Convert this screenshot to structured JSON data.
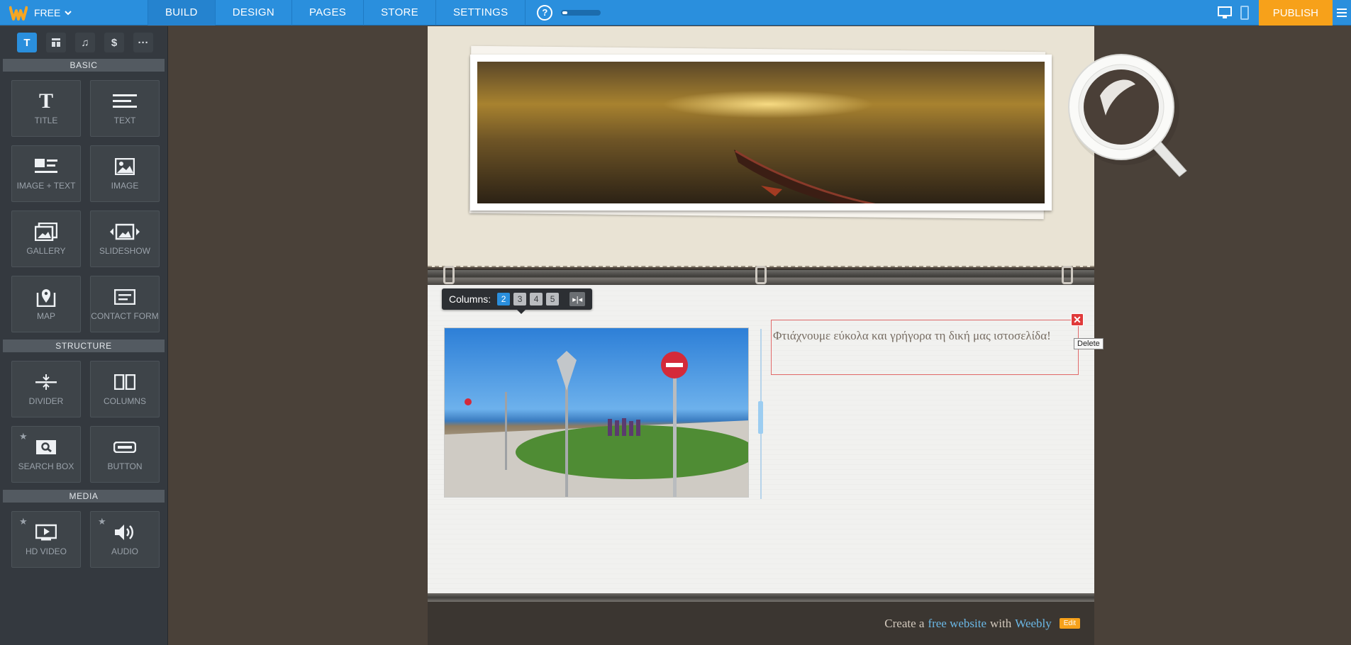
{
  "topbar": {
    "logo": "W",
    "plan": "FREE",
    "tabs": [
      {
        "label": "BUILD",
        "active": true
      },
      {
        "label": "DESIGN",
        "active": false
      },
      {
        "label": "PAGES",
        "active": false
      },
      {
        "label": "STORE",
        "active": false
      },
      {
        "label": "SETTINGS",
        "active": false
      }
    ],
    "help": "?",
    "progress": 0.12,
    "publish": "PUBLISH"
  },
  "sidebar": {
    "sections": {
      "basic": "BASIC",
      "structure": "STRUCTURE",
      "media": "MEDIA"
    },
    "basic_items": [
      {
        "label": "TITLE",
        "icon": "title-icon"
      },
      {
        "label": "TEXT",
        "icon": "text-icon"
      },
      {
        "label": "IMAGE + TEXT",
        "icon": "image-text-icon"
      },
      {
        "label": "IMAGE",
        "icon": "image-icon"
      },
      {
        "label": "GALLERY",
        "icon": "gallery-icon"
      },
      {
        "label": "SLIDESHOW",
        "icon": "slideshow-icon"
      },
      {
        "label": "MAP",
        "icon": "map-icon"
      },
      {
        "label": "CONTACT FORM",
        "icon": "contact-form-icon"
      }
    ],
    "structure_items": [
      {
        "label": "DIVIDER",
        "icon": "divider-icon"
      },
      {
        "label": "COLUMNS",
        "icon": "columns-icon"
      },
      {
        "label": "SEARCH BOX",
        "icon": "search-box-icon",
        "starred": true
      },
      {
        "label": "BUTTON",
        "icon": "button-icon"
      }
    ],
    "media_items": [
      {
        "label": "HD VIDEO",
        "icon": "video-icon",
        "starred": true
      },
      {
        "label": "AUDIO",
        "icon": "audio-icon",
        "starred": true
      }
    ]
  },
  "editor": {
    "columns_label": "Columns:",
    "column_options": [
      "2",
      "3",
      "4",
      "5"
    ],
    "selected_columns": "2",
    "text_content": "Φτιάχνουμε εύκολα και γρήγορα τη δική μας ιστοσελίδα!",
    "delete_tooltip": "Delete"
  },
  "footer": {
    "prefix": "Create a",
    "link1": "free website",
    "middle": "with",
    "link2": "Weebly",
    "edit": "Edit"
  },
  "colors": {
    "topbar": "#2a8fdd",
    "publish": "#f7a11a",
    "sidebar": "#34393f",
    "delete": "#e03a3a"
  }
}
